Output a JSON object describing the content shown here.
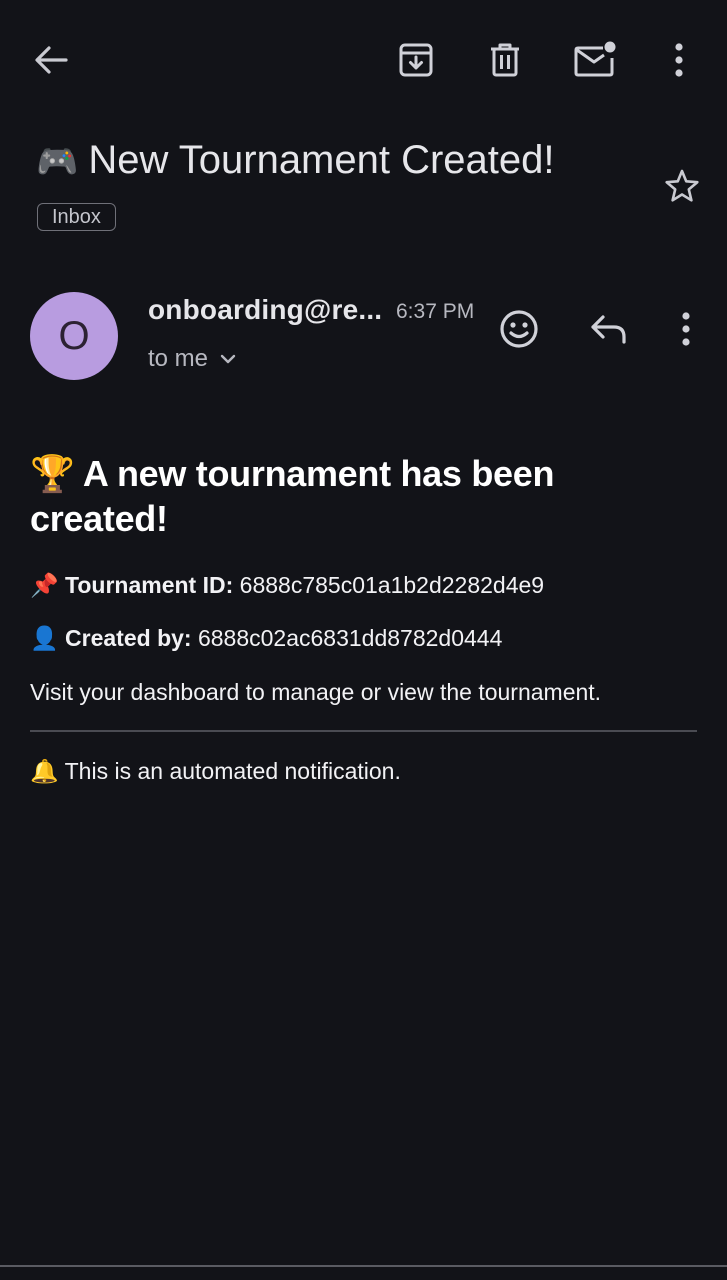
{
  "toolbar": {
    "back_icon": "arrow-left-icon",
    "archive_icon": "archive-icon",
    "delete_icon": "trash-icon",
    "unread_icon": "mark-unread-icon",
    "more_icon": "more-vert-icon"
  },
  "subject": {
    "emoji": "🎮",
    "text": "New Tournament Created!",
    "label": "Inbox",
    "star_icon": "star-outline-icon"
  },
  "message": {
    "avatar_letter": "O",
    "avatar_color": "#b89ce0",
    "sender": "onboarding@re...",
    "time": "6:37 PM",
    "recipient": "to me",
    "emoji_icon": "add-reaction-icon",
    "reply_icon": "reply-icon",
    "more_icon": "more-vert-icon"
  },
  "body": {
    "heading_emoji": "🏆",
    "heading": "A new tournament has been created!",
    "id_emoji": "📌",
    "id_label": "Tournament ID:",
    "id_value": "6888c785c01a1b2d2282d4e9",
    "creator_emoji": "👤",
    "creator_label": "Created by:",
    "creator_value": "6888c02ac6831dd8782d0444",
    "visit_text": "Visit your dashboard to manage or view the tournament.",
    "note_emoji": "🔔",
    "note_text": "This is an automated notification."
  },
  "colors": {
    "background": "#121318",
    "text": "#e3e3e8",
    "divider": "#4a4b52"
  }
}
